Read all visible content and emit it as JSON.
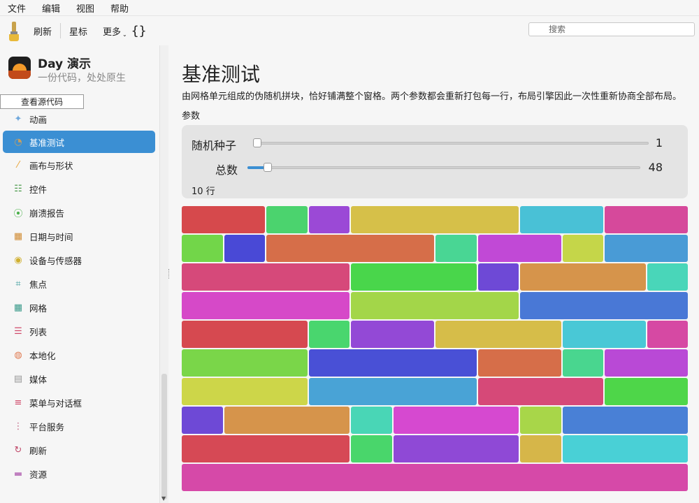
{
  "menu": [
    "文件",
    "编辑",
    "视图",
    "帮助"
  ],
  "toolbar": {
    "refresh": "刷新",
    "star": "星标",
    "more": "更多",
    "more_caret": "⌄",
    "braces": "{}"
  },
  "search": {
    "placeholder": "搜索"
  },
  "app": {
    "title": "Day 演示",
    "subtitle": "一份代码，处处原生"
  },
  "sidebar": {
    "source_button": "查看源代码",
    "items": [
      {
        "label": "动画",
        "icon": "sparkles-icon"
      },
      {
        "label": "基准测试",
        "icon": "gauge-icon",
        "active": true
      },
      {
        "label": "画布与形状",
        "icon": "brush-icon"
      },
      {
        "label": "控件",
        "icon": "sliders-icon"
      },
      {
        "label": "崩溃报告",
        "icon": "broadcast-icon"
      },
      {
        "label": "日期与时间",
        "icon": "calendar-icon"
      },
      {
        "label": "设备与传感器",
        "icon": "sensor-icon"
      },
      {
        "label": "焦点",
        "icon": "focus-icon"
      },
      {
        "label": "网格",
        "icon": "grid-icon"
      },
      {
        "label": "列表",
        "icon": "list-icon"
      },
      {
        "label": "本地化",
        "icon": "globe-icon"
      },
      {
        "label": "媒体",
        "icon": "clapper-icon"
      },
      {
        "label": "菜单与对话框",
        "icon": "menu-icon"
      },
      {
        "label": "平台服务",
        "icon": "dots-icon"
      },
      {
        "label": "刷新",
        "icon": "refresh-icon"
      },
      {
        "label": "资源",
        "icon": "folder-icon"
      }
    ]
  },
  "main": {
    "title": "基准测试",
    "description": "由网格单元组成的伪随机拼块，恰好铺满整个窗格。两个参数都会重新打包每一行，布局引擎因此一次性重新协商全部布局。",
    "section": "参数",
    "seed": {
      "label": "随机种子",
      "value": "1",
      "fraction": 0.0
    },
    "count": {
      "label": "总数",
      "value": "48",
      "fraction": 0.03
    },
    "rows_label": "10 行"
  },
  "tiles": {
    "columns": 12,
    "rows": [
      [
        [
          2,
          "#d6494c"
        ],
        [
          1,
          "#4bd36e"
        ],
        [
          1,
          "#9b49d6"
        ],
        [
          4,
          "#d6c049"
        ],
        [
          2,
          "#49c1d6"
        ],
        [
          2,
          "#d6499b"
        ]
      ],
      [
        [
          1,
          "#72d649"
        ],
        [
          1,
          "#4949d6"
        ],
        [
          4,
          "#d66e49"
        ],
        [
          1,
          "#49d694"
        ],
        [
          2,
          "#c149d6"
        ],
        [
          1,
          "#c5d649"
        ],
        [
          2,
          "#499bd6"
        ]
      ],
      [
        [
          4,
          "#d6497a"
        ],
        [
          3,
          "#49d64b"
        ],
        [
          1,
          "#6e49d6"
        ],
        [
          3,
          "#d6944b"
        ],
        [
          1,
          "#49d6b9"
        ]
      ],
      [
        [
          4,
          "#d649c8"
        ],
        [
          4,
          "#a3d649"
        ],
        [
          4,
          "#4978d6"
        ]
      ],
      [
        [
          3,
          "#d64950"
        ],
        [
          1,
          "#49d66e"
        ],
        [
          2,
          "#9349d6"
        ],
        [
          3,
          "#d6bd49"
        ],
        [
          2,
          "#49c8d6"
        ],
        [
          1,
          "#d649a3"
        ]
      ],
      [
        [
          3,
          "#7ad649"
        ],
        [
          4,
          "#4950d6"
        ],
        [
          2,
          "#d66e49"
        ],
        [
          1,
          "#49d68f"
        ],
        [
          2,
          "#b949d6"
        ]
      ],
      [
        [
          3,
          "#cdd649"
        ],
        [
          4,
          "#49a3d6"
        ],
        [
          3,
          "#d64978"
        ],
        [
          2,
          "#4ed649"
        ]
      ],
      [
        [
          1,
          "#6e49d6"
        ],
        [
          3,
          "#d6944b"
        ],
        [
          1,
          "#49d6b6"
        ],
        [
          3,
          "#d649d0"
        ],
        [
          1,
          "#a8d649"
        ],
        [
          3,
          "#4980d6"
        ]
      ],
      [
        [
          4,
          "#d64955"
        ],
        [
          1,
          "#49d66b"
        ],
        [
          3,
          "#8f49d6"
        ],
        [
          1,
          "#d6b649"
        ],
        [
          3,
          "#49d0d6"
        ]
      ],
      [
        [
          12,
          "#d649a8"
        ]
      ]
    ]
  }
}
